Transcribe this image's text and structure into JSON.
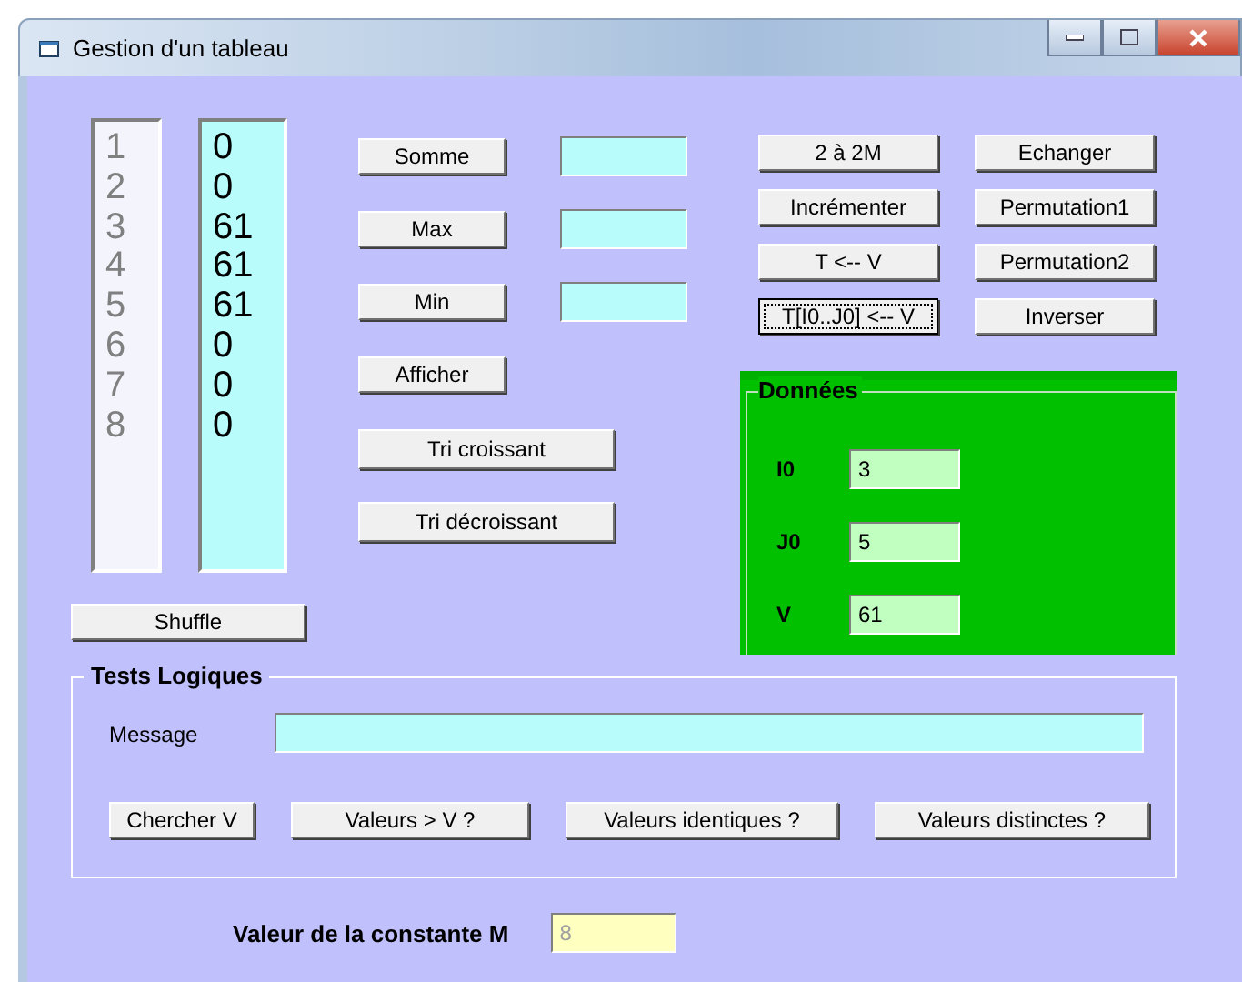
{
  "window": {
    "title": "Gestion d'un tableau"
  },
  "indices": [
    "1",
    "2",
    "3",
    "4",
    "5",
    "6",
    "7",
    "8"
  ],
  "values": [
    "0",
    "0",
    "61",
    "61",
    "61",
    "0",
    "0",
    "0"
  ],
  "compute": [
    {
      "label": "Somme"
    },
    {
      "label": "Max"
    },
    {
      "label": "Min"
    }
  ],
  "show_button": "Afficher",
  "sort_buttons": [
    "Tri croissant",
    "Tri décroissant"
  ],
  "shuffle_button": "Shuffle",
  "action_buttons": [
    {
      "label": "2 à 2M",
      "focused": false
    },
    {
      "label": "Echanger",
      "focused": false
    },
    {
      "label": "Incrémenter",
      "focused": false
    },
    {
      "label": "Permutation1",
      "focused": false
    },
    {
      "label": "T <-- V",
      "focused": false
    },
    {
      "label": "Permutation2",
      "focused": false
    },
    {
      "label": "T[I0..J0] <-- V",
      "focused": true
    },
    {
      "label": "Inverser",
      "focused": false
    }
  ],
  "data_panel": {
    "title": "Données",
    "fields": [
      {
        "label": "I0",
        "value": "3"
      },
      {
        "label": "J0",
        "value": "5"
      },
      {
        "label": "V",
        "value": "61"
      }
    ]
  },
  "tests": {
    "title": "Tests Logiques",
    "message_label": "Message",
    "buttons": [
      "Chercher V",
      "Valeurs  > V ?",
      "Valeurs identiques ?",
      "Valeurs distinctes ?"
    ]
  },
  "constant": {
    "label": "Valeur de la constante M",
    "value": "8",
    "disabled": true
  }
}
